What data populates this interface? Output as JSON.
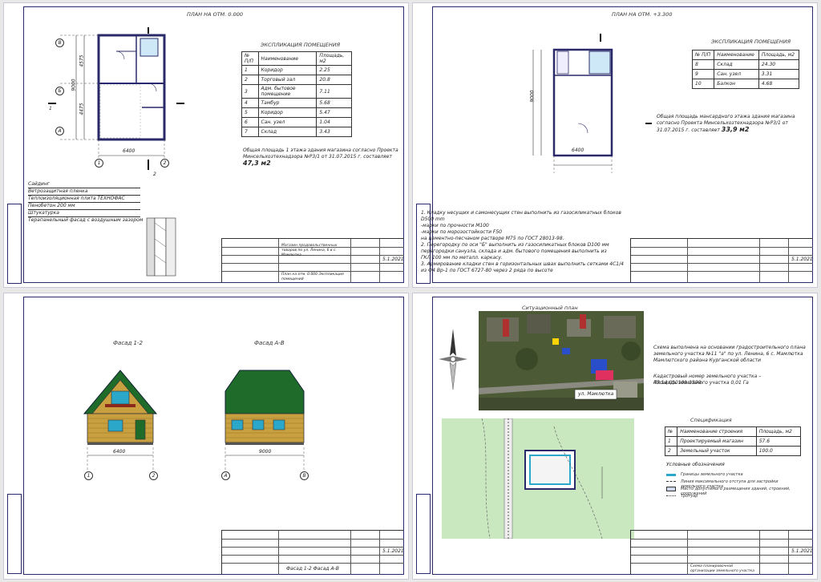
{
  "sheet1": {
    "title": "ПЛАН НА ОТМ. 0.000",
    "table_title": "ЭКСПЛИКАЦИЯ ПОМЕЩЕНИЯ",
    "table_headers": [
      "№ П/П",
      "Наименование",
      "Площадь, м2"
    ],
    "rows": [
      [
        "1",
        "Коридор",
        "2.25"
      ],
      [
        "2",
        "Торговый зал",
        "20.8"
      ],
      [
        "3",
        "Адм. бытовое помещение",
        "7.11"
      ],
      [
        "4",
        "Тамбур",
        "5.68"
      ],
      [
        "5",
        "Коридор",
        "5.47"
      ],
      [
        "6",
        "Сан. узел",
        "1.04"
      ],
      [
        "7",
        "Склад",
        "3.43"
      ]
    ],
    "area_note": "Общая площадь 1 этажа здания магазина согласно Проекта Минсельхозтехнадзора №Р3/1 от 31.07.2015 г.",
    "area_value_prefix": "составляет ",
    "area_value": "47,3 м2",
    "dim_width": "6400",
    "dim_height": "9000",
    "dim_a": "4575",
    "dim_b": "4475",
    "axis_1": "1",
    "axis_2": "2",
    "axis_a": "А",
    "axis_b": "Б",
    "axis_v": "В",
    "section_1": "1",
    "section_2": "2",
    "layers": [
      "Сайдинг",
      "Ветрозащитная пленка",
      "Теплоизоляционная плита ТЕХНОФАС",
      "Пенобетон 200 мм",
      "Штукатурка",
      "Терапанельный фасад с воздушным зазором"
    ],
    "stamp_label": "Магазин продовольственных товаров по ул. Ленина, 6 в с. Мамлютка",
    "stamp_code": "5.1.2021",
    "stamp_sheet": "План на отм. 0.000 Экспликация помещений"
  },
  "sheet2": {
    "title": "ПЛАН НА ОТМ. +3.300",
    "table_title": "ЭКСПЛИКАЦИЯ ПОМЕЩЕНИЯ",
    "table_headers": [
      "№ П/П",
      "Наименование",
      "Площадь, м2"
    ],
    "rows": [
      [
        "8",
        "Склад",
        "24.30"
      ],
      [
        "9",
        "Сан. узел",
        "3.31"
      ],
      [
        "10",
        "Балкон",
        "4.68"
      ]
    ],
    "area_note": "Общая площадь мансардного этажа здания магазина согласно Проекта Минсельхозтехнадзора №Р3/1 от 31.07.2015 г.",
    "area_value_prefix": "составляет ",
    "area_value": "33,9 м2",
    "dim_width": "6400",
    "dim_height": "9000",
    "notes": [
      "1. Кладку несущих и самонесущих стен выполнить из газосиликатных блоков D500 mm",
      "-марки по прочности М100",
      "-марки по морозостойкости F50",
      "на цементно-песчаном растворе М75 по ГОСТ 28013-98.",
      "2. Перегородку по оси \"Б\" выполнить из газосиликатных блоков D100 мм",
      "перегородки санузла, склада и адм. бытового помещения выполнить из",
      "ГКЛ 100 мм по металл. каркасу.",
      "3. Армирование кладки стен в горизонтальных швах выполнить сетками 4С1/4",
      "из Ф4 Вр-1 по ГОСТ 6727-80 через 2 ряда по высоте"
    ],
    "stamp_code": "5.1.2021"
  },
  "sheet3": {
    "facade1": "Фасад 1-2",
    "facade2": "Фасад А-В",
    "dim1": "6400",
    "dim2": "9000",
    "stamp_code": "5.1.2021",
    "stamp_sheet": "Фасад 1-2  Фасад А-В"
  },
  "sheet4": {
    "photo_title": "Ситуационный план",
    "street": "ул. Мамлютка",
    "scheme_note": "Схема выполнена на основании градостроительного плана земельного участка №11 \"а\" по ул. Ленина, 6 с. Мамлютка Мамлютского района Курганской области",
    "cadastral": "Кадастровый номер земельного участка – 45:14:010101:1399",
    "area": "Площадь земельного участка 0,01 Га",
    "spec_title": "Спецификация",
    "spec_headers": [
      "№",
      "Наименование строения",
      "Площадь, м2"
    ],
    "spec_rows": [
      [
        "1",
        "Проектируемый магазин",
        "57.6"
      ],
      [
        "2",
        "Земельный участок",
        "100.0"
      ]
    ],
    "legend_title": "Условные обозначения",
    "legend": [
      "Границы земельного участка",
      "Линия максимального отступа для застройки земельного участка",
      "Место допустимого размещения зданий, строений, сооружений",
      "Тротуар"
    ],
    "stamp_code": "5.1.2021",
    "stamp_sheet": "Схема планировочной организации земельного участка"
  },
  "colors": {
    "ink": "#2a2a6a",
    "wall": "#c9a040",
    "roof": "#1f6b2a",
    "grass": "#c9e8c0",
    "water": "#2aa7c9"
  }
}
